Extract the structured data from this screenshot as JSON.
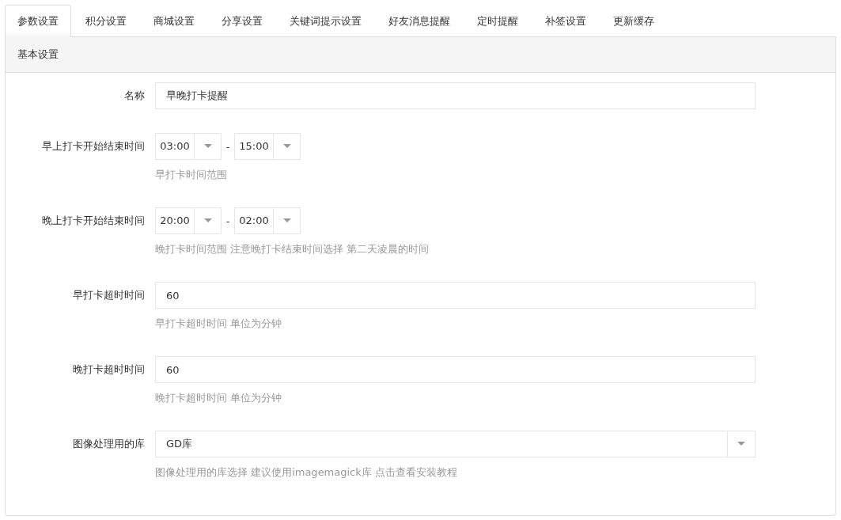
{
  "tabs": [
    {
      "label": "参数设置",
      "selected": true
    },
    {
      "label": "积分设置",
      "selected": false
    },
    {
      "label": "商城设置",
      "selected": false
    },
    {
      "label": "分享设置",
      "selected": false
    },
    {
      "label": "关键词提示设置",
      "selected": false
    },
    {
      "label": "好友消息提醒",
      "selected": false
    },
    {
      "label": "定时提醒",
      "selected": false
    },
    {
      "label": "补签设置",
      "selected": false
    },
    {
      "label": "更新缓存",
      "selected": false
    }
  ],
  "panel": {
    "title": "基本设置",
    "fields": [
      {
        "kind": "text",
        "label": "名称",
        "value": "早晚打卡提醒"
      },
      {
        "kind": "timerange",
        "label": "早上打卡开始结束时间",
        "start": "03:00",
        "separator": "-",
        "end": "15:00",
        "help": "早打卡时间范围"
      },
      {
        "kind": "timerange",
        "label": "晚上打卡开始结束时间",
        "start": "20:00",
        "separator": "-",
        "end": "02:00",
        "help": "晚打卡时间范围 注意晚打卡结束时间选择 第二天凌晨的时间"
      },
      {
        "kind": "text",
        "label": "早打卡超时时间",
        "value": "60",
        "help": "早打卡超时时间 单位为分钟"
      },
      {
        "kind": "text",
        "label": "晚打卡超时时间",
        "value": "60",
        "help": "晚打卡超时时间 单位为分钟"
      },
      {
        "kind": "select",
        "label": "图像处理用的库",
        "value": "GD库",
        "help": "图像处理用的库选择 建议使用imagemagick库 点击查看安装教程"
      }
    ]
  }
}
